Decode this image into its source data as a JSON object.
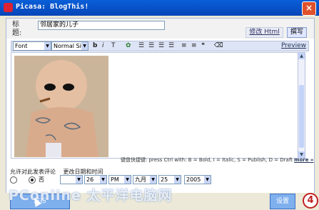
{
  "window": {
    "title": "Picasa: BlogThis!",
    "close": "×"
  },
  "form": {
    "title_label_line1": "标",
    "title_label_line2": "题:",
    "title_value": "邻居家的儿子",
    "tab_html": "修改 Html",
    "tab_compose": "撰写"
  },
  "toolbar": {
    "font": "Font",
    "size": "Normal Size",
    "bold": "b",
    "italic": "i",
    "textcolor": "T",
    "preview": "Preview"
  },
  "editor": {
    "hint_label": "键盘快捷键:",
    "hint_text": "press Ctrl with: B = Bold, I = Italic, S = Publish, D = Draft",
    "hint_more": "more »"
  },
  "options": {
    "comments_label": "允许对此发表评论",
    "date_label": "更改日期和时间",
    "radio_no": "否",
    "minute": "26",
    "ampm": "PM",
    "month": "九月",
    "day": "25",
    "year": "2005"
  },
  "buttons": {
    "publish": "发布",
    "settings": "设置"
  },
  "watermark": "PConline 太平洋电脑网",
  "step_badge": "4"
}
